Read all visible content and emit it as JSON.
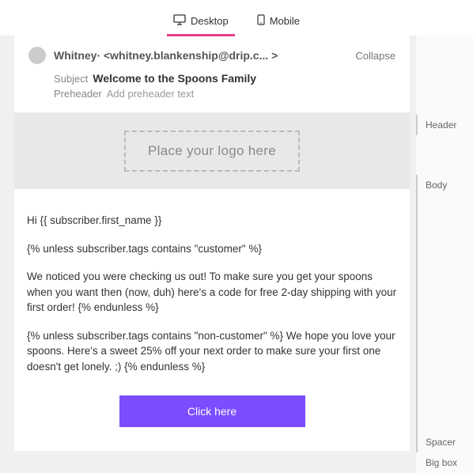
{
  "tabs": {
    "desktop": "Desktop",
    "mobile": "Mobile"
  },
  "header": {
    "sender": "Whitney· <whitney.blankenship@drip.c...  >",
    "collapse": "Collapse",
    "subject_label": "Subject",
    "subject_value": "Welcome to the Spoons Family",
    "preheader_label": "Preheader",
    "preheader_placeholder": "Add preheader text"
  },
  "logo": {
    "placeholder": "Place your logo here"
  },
  "body": {
    "p1": "Hi {{ subscriber.first_name }}",
    "p2": "{% unless subscriber.tags contains \"customer\" %}",
    "p3": "We noticed you were checking us out! To make sure you get your spoons when you want then (now, duh) here's a code for free 2-day shipping with your first order! {% endunless %}",
    "p4": "{% unless subscriber.tags contains \"non-customer\" %} We hope you love your spoons. Here's a sweet 25% off your next order to make sure your first one doesn't get lonely. ;) {% endunless %}",
    "cta": "Click here"
  },
  "side": {
    "header": "Header",
    "body": "Body",
    "spacer": "Spacer",
    "bigbox": "Big box"
  }
}
